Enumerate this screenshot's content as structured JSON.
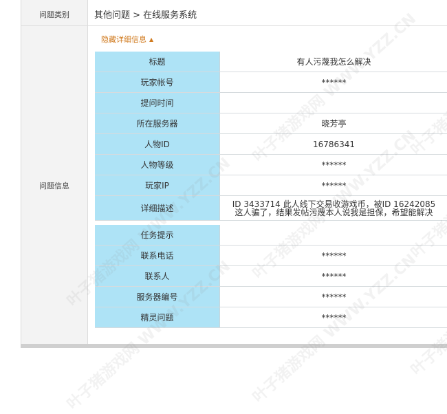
{
  "problem_type": {
    "label": "问题类别",
    "breadcrumb": "其他问题 > 在线服务系统"
  },
  "problem_info": {
    "label": "问题信息",
    "toggle": "隐藏详细信息",
    "rows": [
      {
        "key": "标题",
        "value": "有人污蔑我怎么解决"
      },
      {
        "key": "玩家帐号",
        "value": "******"
      },
      {
        "key": "提问时间",
        "value": ""
      },
      {
        "key": "所在服务器",
        "value": "晓芳亭"
      },
      {
        "key": "人物ID",
        "value": "16786341"
      },
      {
        "key": "人物等级",
        "value": "******"
      },
      {
        "key": "玩家IP",
        "value": "******"
      },
      {
        "key": "详细描述",
        "value_line1": "ID 3433714 此人线下交易收游戏币，被ID 16242085",
        "value_line2": "这人骗了，结果发帖污蔑本人说我是担保，希望能解决"
      },
      {
        "key": "任务提示",
        "value": ""
      },
      {
        "key": "联系电话",
        "value": "******"
      },
      {
        "key": "联系人",
        "value": "******"
      },
      {
        "key": "服务器编号",
        "value": "******"
      },
      {
        "key": "精灵问题",
        "value": "******"
      }
    ]
  },
  "watermark": "叶子猪游戏网 WWW.YZZ.CN",
  "colors": {
    "key_bg": "#aee3f6",
    "toggle": "#d07a1e",
    "side_bg": "#f3f3f3"
  }
}
